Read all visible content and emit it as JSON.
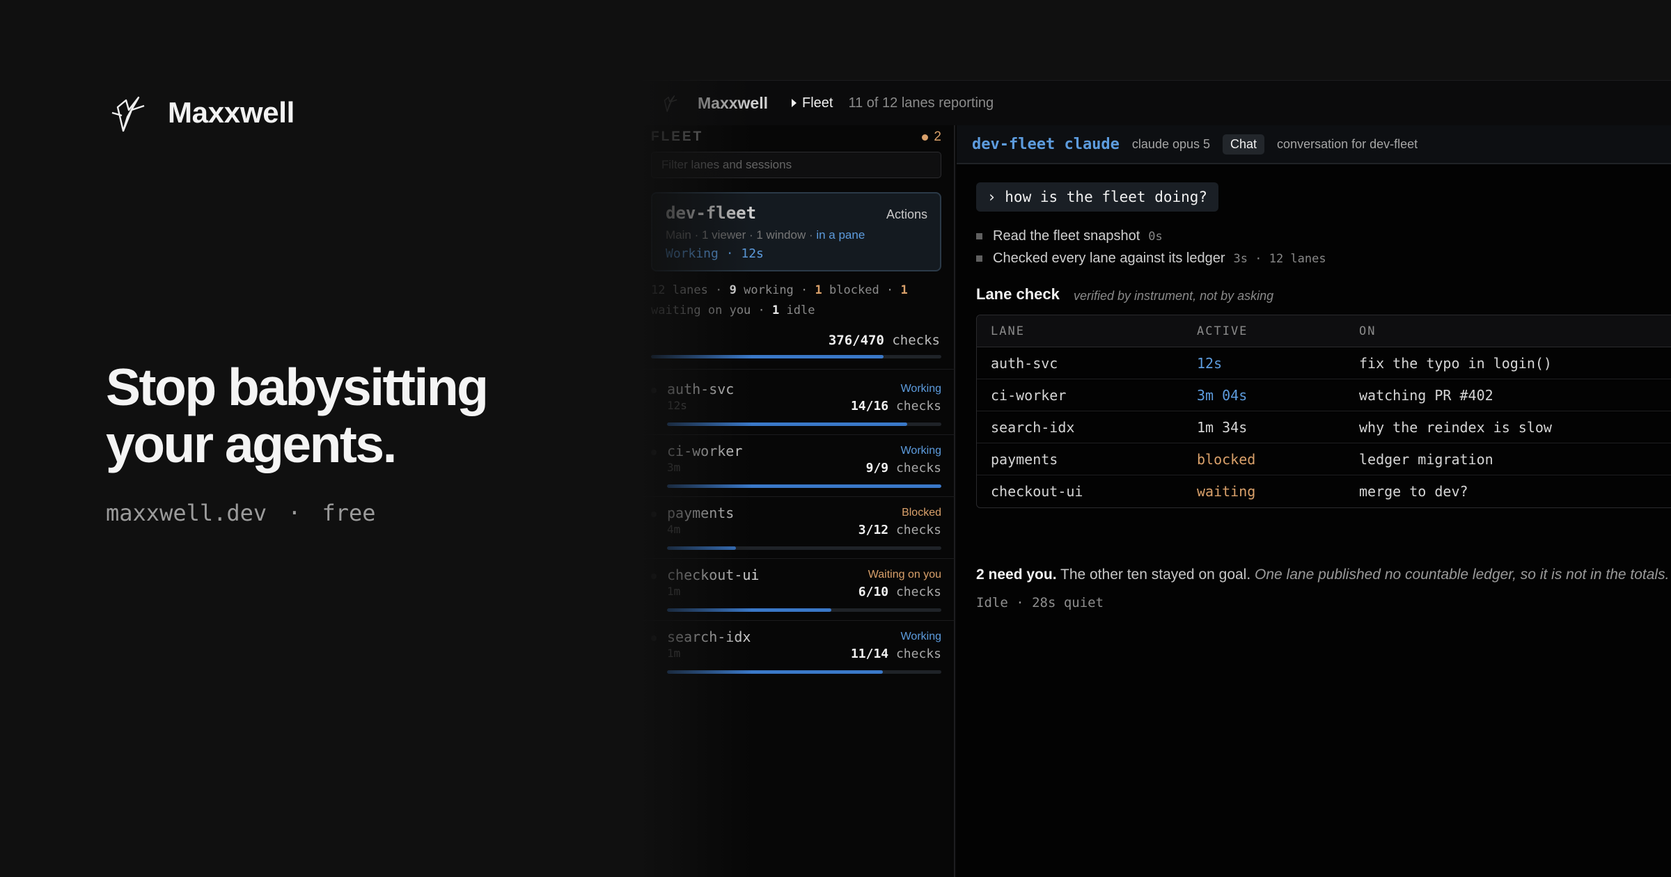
{
  "brand": {
    "name": "Maxxwell"
  },
  "hero": {
    "headline_line1": "Stop babysitting",
    "headline_line2": "your agents.",
    "site": "maxxwell.dev",
    "separator": "·",
    "price": "free"
  },
  "app": {
    "title": "Maxxwell",
    "breadcrumb": "Fleet",
    "reporting": "11 of 12 lanes reporting"
  },
  "sidebar": {
    "label": "FLEET",
    "alert_count": "2",
    "filter_placeholder": "Filter lanes and sessions",
    "session": {
      "name": "dev-fleet",
      "actions": "Actions",
      "meta": "Main · 1 viewer · 1 window · ",
      "meta_link": "in a pane",
      "state": "Working · 12s"
    },
    "summary": {
      "lanes_label": "12 lanes",
      "dot": "·",
      "working_n": "9",
      "working_label": "working",
      "blocked_n": "1",
      "blocked_label": "blocked",
      "waiting_n": "1",
      "waiting_label": "waiting on you",
      "idle_n": "1",
      "idle_label": "idle"
    },
    "total": {
      "value": "376/470",
      "label": "checks",
      "progress": 0.8
    },
    "lanes": [
      {
        "name": "auth-svc",
        "time": "12s",
        "status": "Working",
        "status_kind": "working",
        "checks": "14/16",
        "checks_label": "checks",
        "progress": 0.875
      },
      {
        "name": "ci-worker",
        "time": "3m",
        "status": "Working",
        "status_kind": "working",
        "checks": "9/9",
        "checks_label": "checks",
        "progress": 1.0
      },
      {
        "name": "payments",
        "time": "4m",
        "status": "Blocked",
        "status_kind": "blocked",
        "checks": "3/12",
        "checks_label": "checks",
        "progress": 0.25
      },
      {
        "name": "checkout-ui",
        "time": "1m",
        "status": "Waiting on you",
        "status_kind": "waiting",
        "checks": "6/10",
        "checks_label": "checks",
        "progress": 0.6
      },
      {
        "name": "search-idx",
        "time": "1m",
        "status": "Working",
        "status_kind": "working",
        "checks": "11/14",
        "checks_label": "checks",
        "progress": 0.786
      }
    ]
  },
  "main": {
    "agent": "dev-fleet claude",
    "model": "claude opus 5",
    "tab": "Chat",
    "conversation": "conversation for dev-fleet",
    "prompt": "› how is the fleet doing?",
    "steps": [
      {
        "text": "Read the fleet snapshot",
        "duration": "0s"
      },
      {
        "text": "Checked every lane against its ledger",
        "duration": "3s · 12 lanes"
      }
    ],
    "lane_check": {
      "title": "Lane check",
      "subtitle": "verified by instrument, not by asking",
      "columns": [
        "LANE",
        "ACTIVE",
        "ON"
      ],
      "rows": [
        {
          "lane": "auth-svc",
          "active": "12s",
          "active_kind": "blue",
          "on": "fix the typo in login()"
        },
        {
          "lane": "ci-worker",
          "active": "3m 04s",
          "active_kind": "blue",
          "on": "watching PR #402"
        },
        {
          "lane": "search-idx",
          "active": "1m 34s",
          "active_kind": "plain",
          "on": "why the reindex is slow"
        },
        {
          "lane": "payments",
          "active": "blocked",
          "active_kind": "orange",
          "on": "ledger migration"
        },
        {
          "lane": "checkout-ui",
          "active": "waiting",
          "active_kind": "orange",
          "on": "merge to dev?"
        }
      ]
    },
    "conclusion": {
      "bold": "2 need you.",
      "plain": " The other ten stayed on goal. ",
      "italic": "One lane published no countable ledger, so it is not in the totals."
    },
    "idle": "Idle · 28s quiet"
  },
  "colors": {
    "accent": "#5d9cde",
    "warning": "#d9a06a",
    "progress": "#3a78c8"
  }
}
